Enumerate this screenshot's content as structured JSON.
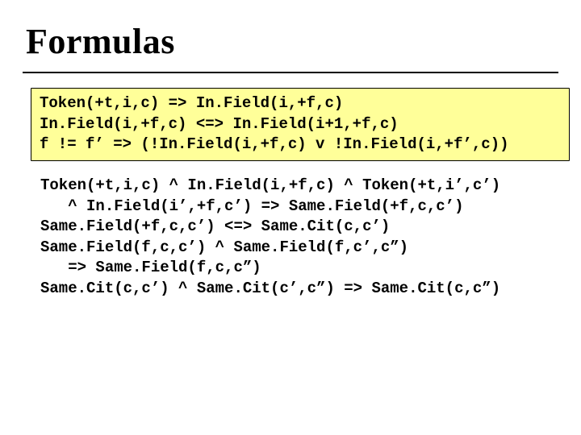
{
  "title": "Formulas",
  "block1": {
    "line1": "Token(+t,i,c) => In.Field(i,+f,c)",
    "line2": "In.Field(i,+f,c) <=> In.Field(i+1,+f,c)",
    "line3": "f != f’ => (!In.Field(i,+f,c) v !In.Field(i,+f’,c))"
  },
  "block2": {
    "line1": "Token(+t,i,c) ^ In.Field(i,+f,c) ^ Token(+t,i’,c’)",
    "line2": "   ^ In.Field(i’,+f,c’) => Same.Field(+f,c,c’)",
    "line3": "Same.Field(+f,c,c’) <=> Same.Cit(c,c’)",
    "line4": "Same.Field(f,c,c’) ^ Same.Field(f,c’,c”)",
    "line5": "   => Same.Field(f,c,c”)",
    "line6": "Same.Cit(c,c’) ^ Same.Cit(c’,c”) => Same.Cit(c,c”)"
  }
}
